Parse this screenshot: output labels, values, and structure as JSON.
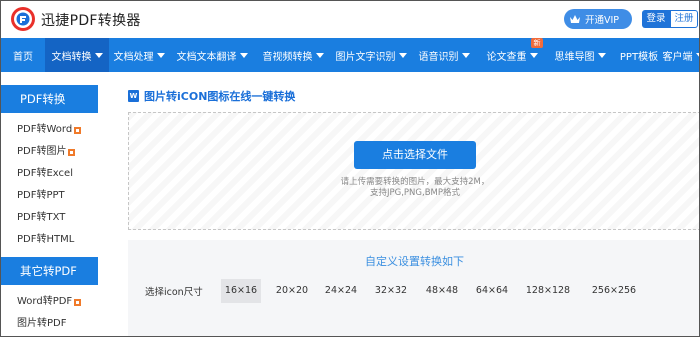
{
  "header": {
    "brand": "迅捷PDF转换器",
    "vip_label": "开通VIP",
    "login_label": "登录",
    "register_label": "注册"
  },
  "nav": {
    "items": [
      {
        "label": "首页",
        "dropdown": false,
        "active": false
      },
      {
        "label": "文档转换",
        "dropdown": true,
        "active": true
      },
      {
        "label": "文档处理",
        "dropdown": true,
        "active": false
      },
      {
        "label": "文档文本翻译",
        "dropdown": true,
        "active": false
      },
      {
        "label": "音视频转换",
        "dropdown": true,
        "active": false
      },
      {
        "label": "图片文字识别",
        "dropdown": true,
        "active": false
      },
      {
        "label": "语音识别",
        "dropdown": true,
        "active": false
      },
      {
        "label": "论文查重",
        "dropdown": true,
        "active": false,
        "badge": "新"
      },
      {
        "label": "思维导图",
        "dropdown": true,
        "active": false
      },
      {
        "label": "PPT模板",
        "dropdown": false,
        "active": false
      },
      {
        "label": "客户端",
        "dropdown": true,
        "active": false
      }
    ]
  },
  "sidebar": {
    "section1_title": "PDF转换",
    "section1_items": [
      {
        "label": "PDF转Word",
        "hot": true
      },
      {
        "label": "PDF转图片",
        "hot": true
      },
      {
        "label": "PDF转Excel",
        "hot": false
      },
      {
        "label": "PDF转PPT",
        "hot": false
      },
      {
        "label": "PDF转TXT",
        "hot": false
      },
      {
        "label": "PDF转HTML",
        "hot": false
      }
    ],
    "section2_title": "其它转PDF",
    "section2_items": [
      {
        "label": "Word转PDF",
        "hot": true
      },
      {
        "label": "图片转PDF",
        "hot": false
      }
    ]
  },
  "main": {
    "title_icon_letter": "W",
    "title": "图片转iCON图标在线一键转换",
    "upload_button": "点击选择文件",
    "upload_hint_line1": "请上传需要转换的图片，最大支持2M，",
    "upload_hint_line2": "支持JPG,PNG,BMP格式",
    "settings_title": "自定义设置转换如下",
    "size_label": "选择icon尺寸",
    "sizes": [
      "16×16",
      "20×20",
      "24×24",
      "32×32",
      "48×48",
      "64×64",
      "128×128",
      "256×256"
    ],
    "selected_size_index": 0
  },
  "colors": {
    "nav_blue": "#1a7ee0",
    "title_blue": "#1a6fd8",
    "badge_orange": "#f26b3a"
  }
}
